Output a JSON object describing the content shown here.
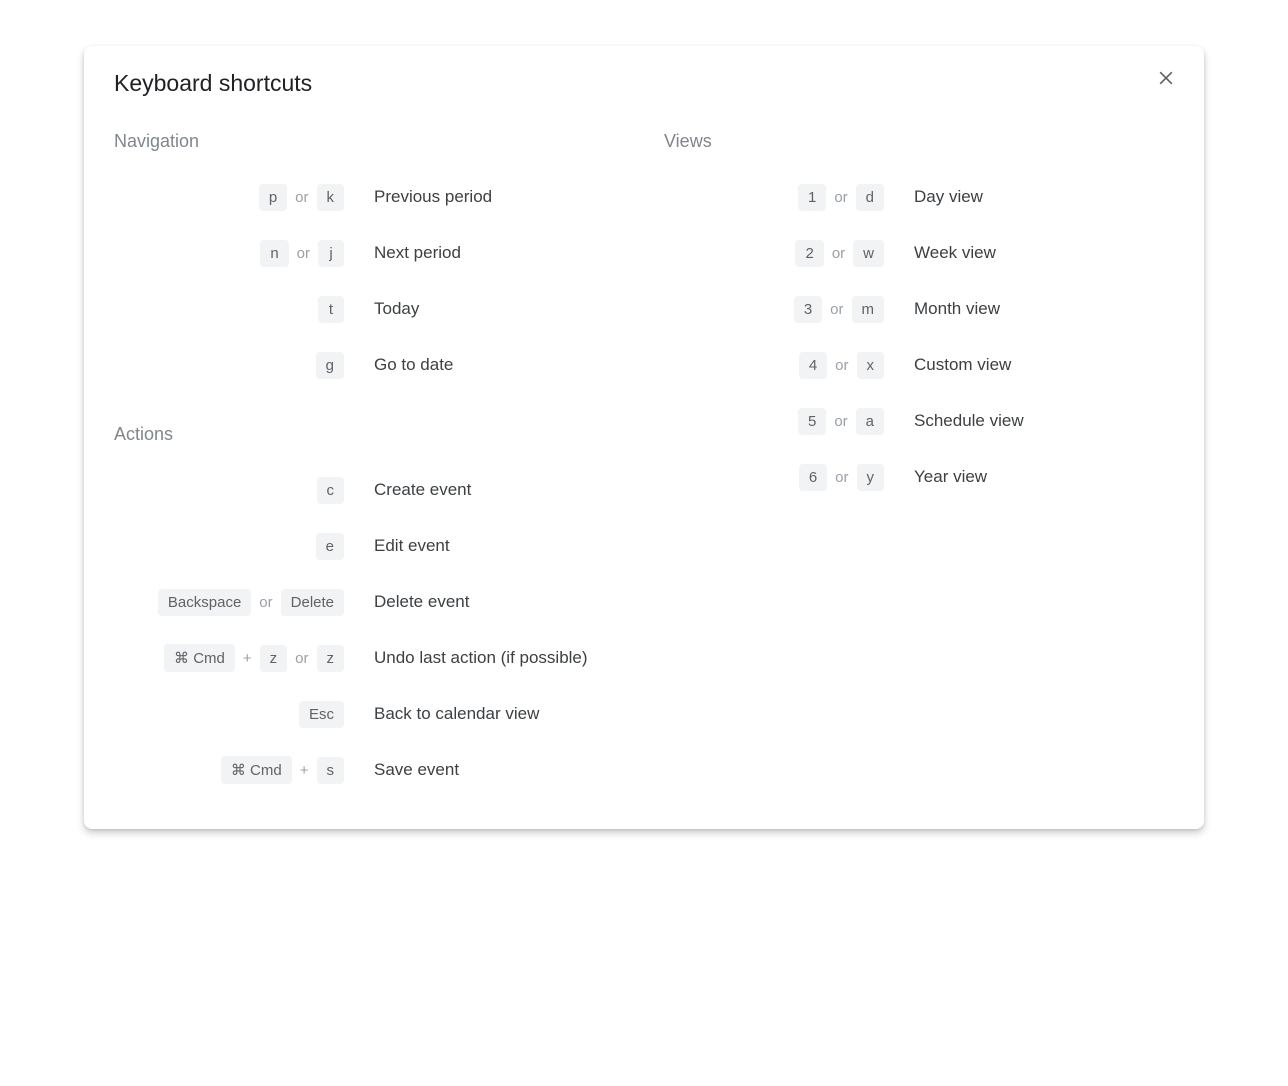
{
  "title": "Keyboard shortcuts",
  "or": "or",
  "plus": "+",
  "sections": {
    "navigation": {
      "header": "Navigation",
      "rows": [
        {
          "keys": [
            [
              "p"
            ],
            [
              "k"
            ]
          ],
          "desc": "Previous period"
        },
        {
          "keys": [
            [
              "n"
            ],
            [
              "j"
            ]
          ],
          "desc": "Next period"
        },
        {
          "keys": [
            [
              "t"
            ]
          ],
          "desc": "Today"
        },
        {
          "keys": [
            [
              "g"
            ]
          ],
          "desc": "Go to date"
        }
      ]
    },
    "views": {
      "header": "Views",
      "rows": [
        {
          "keys": [
            [
              "1"
            ],
            [
              "d"
            ]
          ],
          "desc": "Day view"
        },
        {
          "keys": [
            [
              "2"
            ],
            [
              "w"
            ]
          ],
          "desc": "Week view"
        },
        {
          "keys": [
            [
              "3"
            ],
            [
              "m"
            ]
          ],
          "desc": "Month view"
        },
        {
          "keys": [
            [
              "4"
            ],
            [
              "x"
            ]
          ],
          "desc": "Custom view"
        },
        {
          "keys": [
            [
              "5"
            ],
            [
              "a"
            ]
          ],
          "desc": "Schedule view"
        },
        {
          "keys": [
            [
              "6"
            ],
            [
              "y"
            ]
          ],
          "desc": "Year view"
        }
      ]
    },
    "actions": {
      "header": "Actions",
      "rows": [
        {
          "keys": [
            [
              "c"
            ]
          ],
          "desc": "Create event"
        },
        {
          "keys": [
            [
              "e"
            ]
          ],
          "desc": "Edit event"
        },
        {
          "keys": [
            [
              "Backspace"
            ],
            [
              "Delete"
            ]
          ],
          "desc": "Delete event"
        },
        {
          "keys": [
            [
              "⌘ Cmd",
              "z"
            ],
            [
              "z"
            ]
          ],
          "desc": "Undo last action (if possible)"
        },
        {
          "keys": [
            [
              "Esc"
            ]
          ],
          "desc": "Back to calendar view"
        },
        {
          "keys": [
            [
              "⌘ Cmd",
              "s"
            ]
          ],
          "desc": "Save event"
        }
      ]
    }
  }
}
